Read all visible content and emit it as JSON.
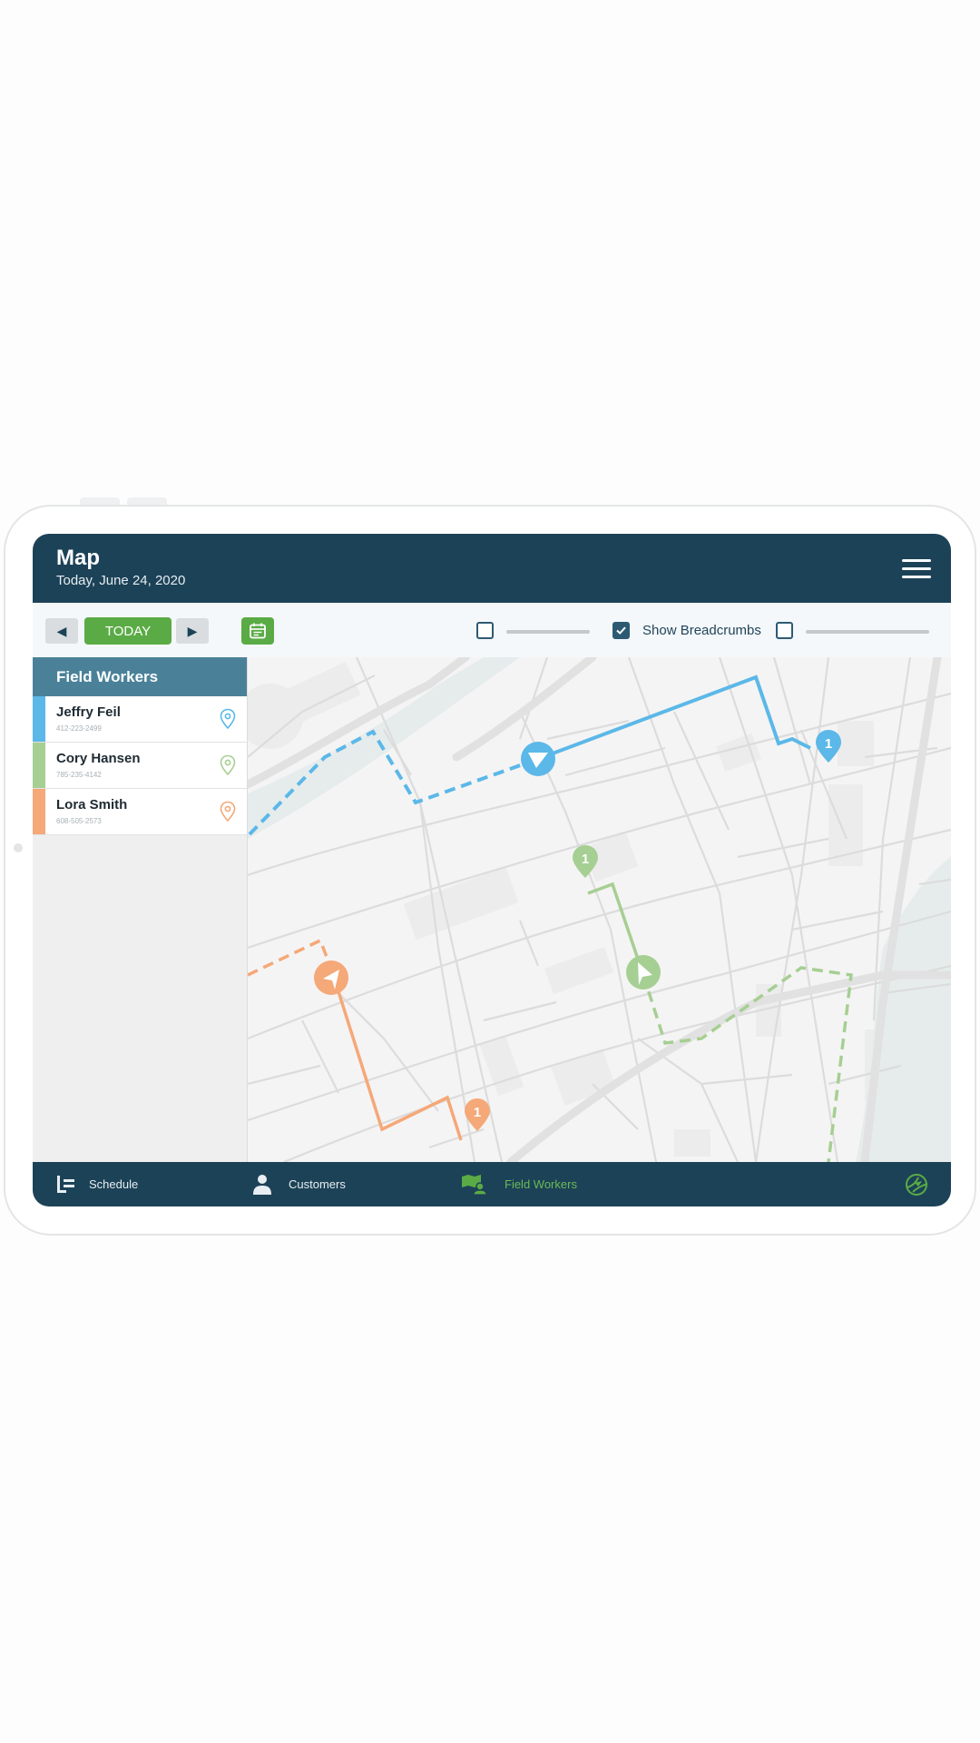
{
  "header": {
    "title": "Map",
    "date": "Today, June 24, 2020"
  },
  "toolbar": {
    "prev_symbol": "◀",
    "today_label": "TODAY",
    "next_symbol": "▶",
    "show_breadcrumbs_label": "Show Breadcrumbs",
    "checkbox1_checked": false,
    "breadcrumbs_checked": true,
    "checkbox3_checked": false
  },
  "sidebar": {
    "title": "Field Workers",
    "workers": [
      {
        "name": "Jeffry Feil",
        "phone": "412-223-2499",
        "color": "#5bb8e8"
      },
      {
        "name": "Cory Hansen",
        "phone": "785-235-4142",
        "color": "#a6cf93"
      },
      {
        "name": "Lora Smith",
        "phone": "608-505-2573",
        "color": "#f5a878"
      }
    ]
  },
  "map": {
    "marker_labels": [
      "1",
      "1",
      "1"
    ]
  },
  "bottom_nav": {
    "tabs": [
      {
        "label": "Schedule",
        "active": false
      },
      {
        "label": "Customers",
        "active": false
      },
      {
        "label": "Field Workers",
        "active": true
      }
    ]
  },
  "colors": {
    "header": "#1c4257",
    "accent_green": "#5aab45",
    "sidebar_head": "#4a8199"
  }
}
